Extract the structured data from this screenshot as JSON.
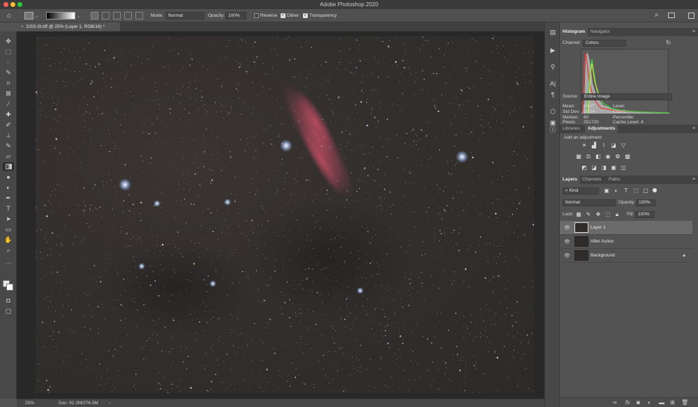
{
  "window": {
    "title": "Adobe Photoshop 2020"
  },
  "options_bar": {
    "mode_label": "Mode:",
    "mode_value": "Normal",
    "opacity_label": "Opacity:",
    "opacity_value": "100%",
    "reverse_label": "Reverse",
    "dither_label": "Dither",
    "transparency_label": "Transparency",
    "reverse_checked": false,
    "dither_checked": true,
    "transparency_checked": true
  },
  "document": {
    "tab_title": "DSS-St.tiff @ 25% (Layer 1, RGB/16) *"
  },
  "status": {
    "zoom": "25%",
    "doc_size": "Doc: 92.2M/276.5M"
  },
  "histogram_panel": {
    "tabs": [
      "Histogram",
      "Navigator"
    ],
    "channel_label": "Channel:",
    "channel_value": "Colors",
    "source_label": "Source:",
    "source_value": "Entire Image",
    "stats_left": [
      {
        "label": "Mean:",
        "value": "64.97"
      },
      {
        "label": "Std Dev:",
        "value": "16.94"
      },
      {
        "label": "Median:",
        "value": "60"
      },
      {
        "label": "Pixels:",
        "value": "251720"
      }
    ],
    "stats_right": [
      {
        "label": "Level:",
        "value": ""
      },
      {
        "label": "Count:",
        "value": ""
      },
      {
        "label": "Percentile:",
        "value": ""
      },
      {
        "label": "Cache Level:",
        "value": "4"
      }
    ]
  },
  "adjustments_panel": {
    "tabs": [
      "Libraries",
      "Adjustments"
    ],
    "hint": "Add an adjustment"
  },
  "layers_panel": {
    "tabs": [
      "Layers",
      "Channels",
      "Paths"
    ],
    "filter_value": "Kind",
    "blend_mode": "Normal",
    "opacity_label": "Opacity:",
    "opacity_value": "100%",
    "lock_label": "Lock:",
    "fill_label": "Fill:",
    "fill_value": "100%",
    "layers": [
      {
        "name": "Layer 1",
        "selected": true,
        "locked": false
      },
      {
        "name": "After Action",
        "selected": false,
        "locked": false
      },
      {
        "name": "Background",
        "selected": false,
        "locked": true
      }
    ]
  },
  "colors": {
    "background": "#535353",
    "nebula": "#b4465a",
    "histogram_red": "#e23a3a",
    "histogram_green": "#3ecf3e"
  }
}
